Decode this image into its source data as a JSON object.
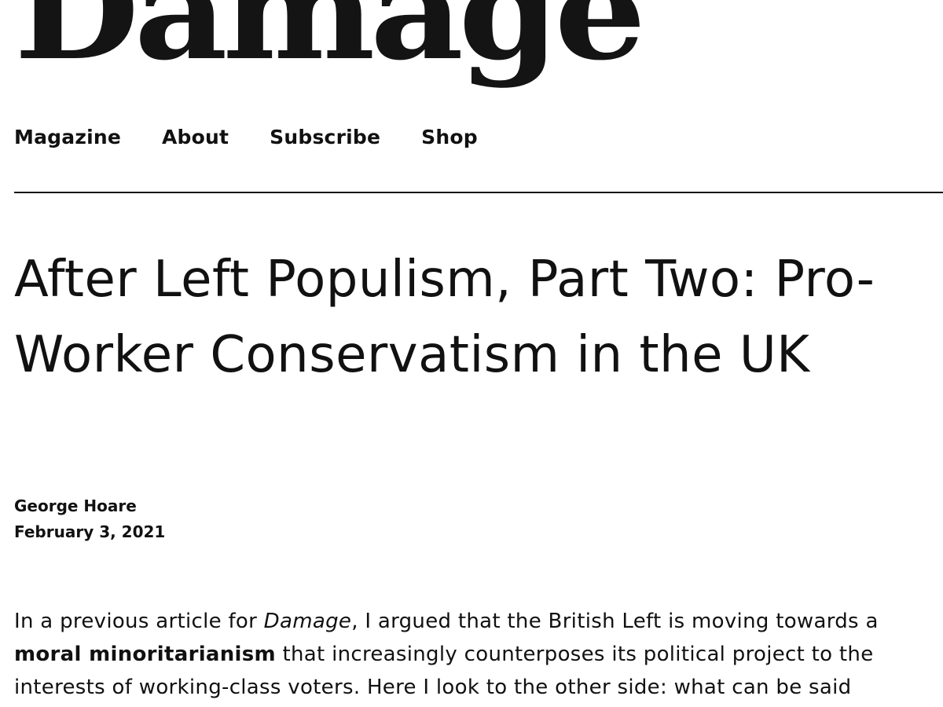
{
  "site": {
    "logo_text": "Damage"
  },
  "nav": {
    "items": [
      {
        "label": "Magazine"
      },
      {
        "label": "About"
      },
      {
        "label": "Subscribe"
      },
      {
        "label": "Shop"
      }
    ]
  },
  "article": {
    "title": "After Left Populism, Part Two: Pro-Worker Conservatism in the UK",
    "author": "George Hoare",
    "date": "February 3, 2021",
    "body": {
      "p1_text_1": "In a previous article for ",
      "p1_publication": "Damage",
      "p1_text_2": ", I argued that the British Left is moving towards a ",
      "p1_bold": "moral minoritarianism",
      "p1_text_3": " that increasingly counterposes its political project to the interests of working-class voters. Here I look to the other side: what can be said"
    }
  },
  "colors": {
    "text": "#111111",
    "background": "#ffffff"
  }
}
